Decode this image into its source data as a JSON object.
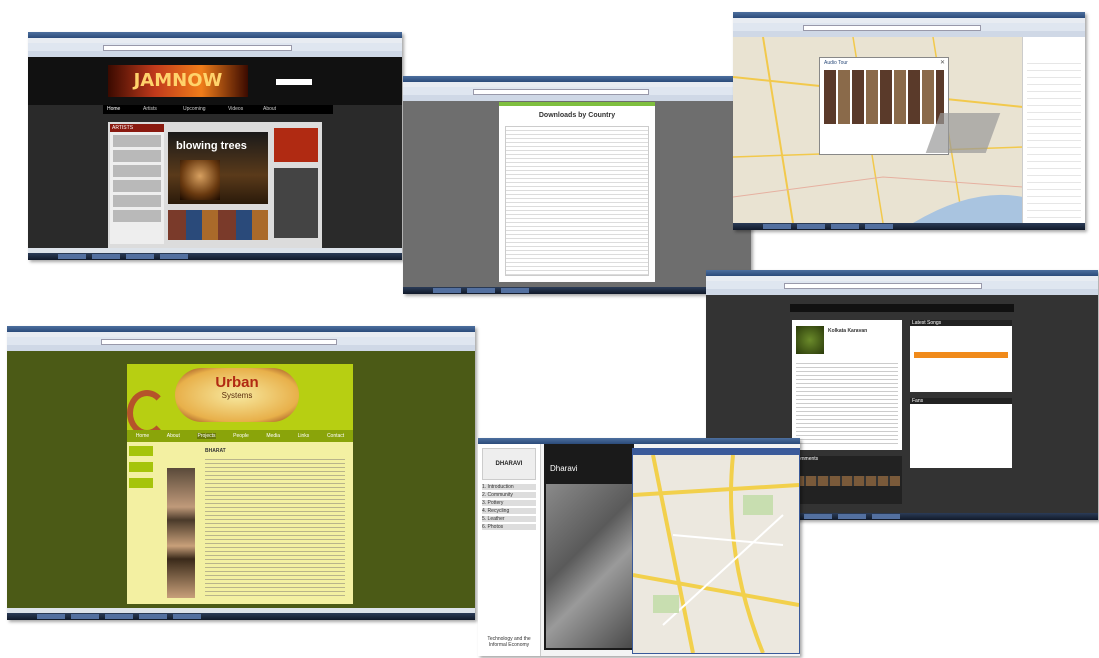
{
  "screens": {
    "jamnow": {
      "logo": "JAMNOW",
      "banner": "blowing trees",
      "sidebar_heading": "ARTISTS",
      "nav": [
        "Home",
        "Artists",
        "Upcoming",
        "Videos",
        "About"
      ]
    },
    "downloads": {
      "title": "Downloads by Country"
    },
    "map": {
      "popup_title": "Audio Tour",
      "colors": {
        "land": "#e9e3d2",
        "water": "#a9c4e0",
        "road": "#f2c94c"
      }
    },
    "urban": {
      "logo_top": "Urban",
      "logo_bottom": "Systems",
      "heading": "BHARAT",
      "menu": [
        "Home",
        "About",
        "Projects",
        "People",
        "Media",
        "Links",
        "Contact"
      ],
      "colors": {
        "olive": "#4b5a16",
        "lime": "#a6c40a",
        "cream": "#f3f0a2"
      }
    },
    "profile": {
      "artist": "Kolkata Karavan",
      "sections": [
        "Latest Songs",
        "Fans",
        "Comments"
      ]
    },
    "dharavi": {
      "logo": "DHARAVI",
      "page_title": "Dharavi",
      "sidebar_items": [
        "1. Introduction",
        "2. Community",
        "3. Pottery",
        "4. Recycling",
        "5. Leather",
        "6. Photos"
      ],
      "footer": "Technology and the Informal Economy"
    }
  }
}
